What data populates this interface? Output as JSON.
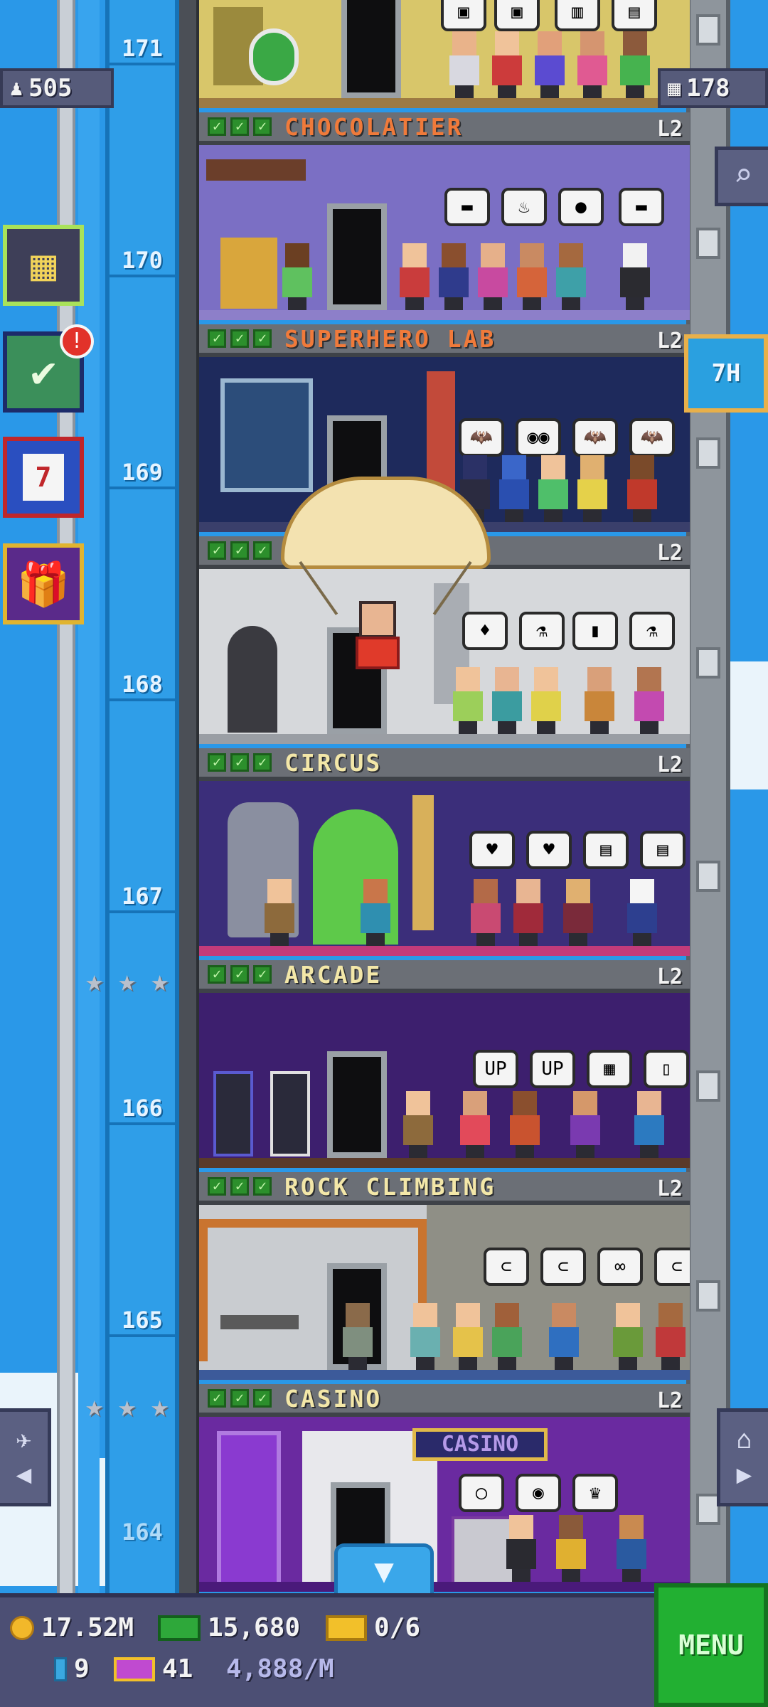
{
  "hud": {
    "population": "505",
    "floors": "178",
    "timer": "7H"
  },
  "floors": [
    {
      "number": "171",
      "name": "",
      "level": ""
    },
    {
      "number": "170",
      "name": "CHOCOLATIER",
      "level": "L2"
    },
    {
      "number": "169",
      "name": "SUPERHERO LAB",
      "level": "L2"
    },
    {
      "number": "168",
      "name": "",
      "level": "L2"
    },
    {
      "number": "167",
      "name": "CIRCUS",
      "level": "L2"
    },
    {
      "number": "166",
      "name": "ARCADE",
      "level": "L2"
    },
    {
      "number": "165",
      "name": "ROCK CLIMBING",
      "level": "L2"
    },
    {
      "number": "164",
      "name": "CASINO",
      "level": "L2"
    }
  ],
  "casino_sign": "CASINO",
  "side_buttons": {
    "tower_icon": "building-icon",
    "missions_icon": "checklist-icon",
    "missions_alert": "!",
    "calendar_icon": "calendar-icon",
    "calendar_day": "7",
    "gift_icon": "gift-icon"
  },
  "bottom": {
    "coins": "17.52M",
    "bux": "15,680",
    "tickets": "0/6",
    "keys": "9",
    "gold_tickets": "41",
    "rate": "4,888/M",
    "menu_label": "MENU"
  },
  "colors": {
    "sky": "#2a98e8",
    "floor_label": "#f07a3a",
    "floor_label_alt": "#f3e7a8",
    "menu_green": "#22b032"
  }
}
